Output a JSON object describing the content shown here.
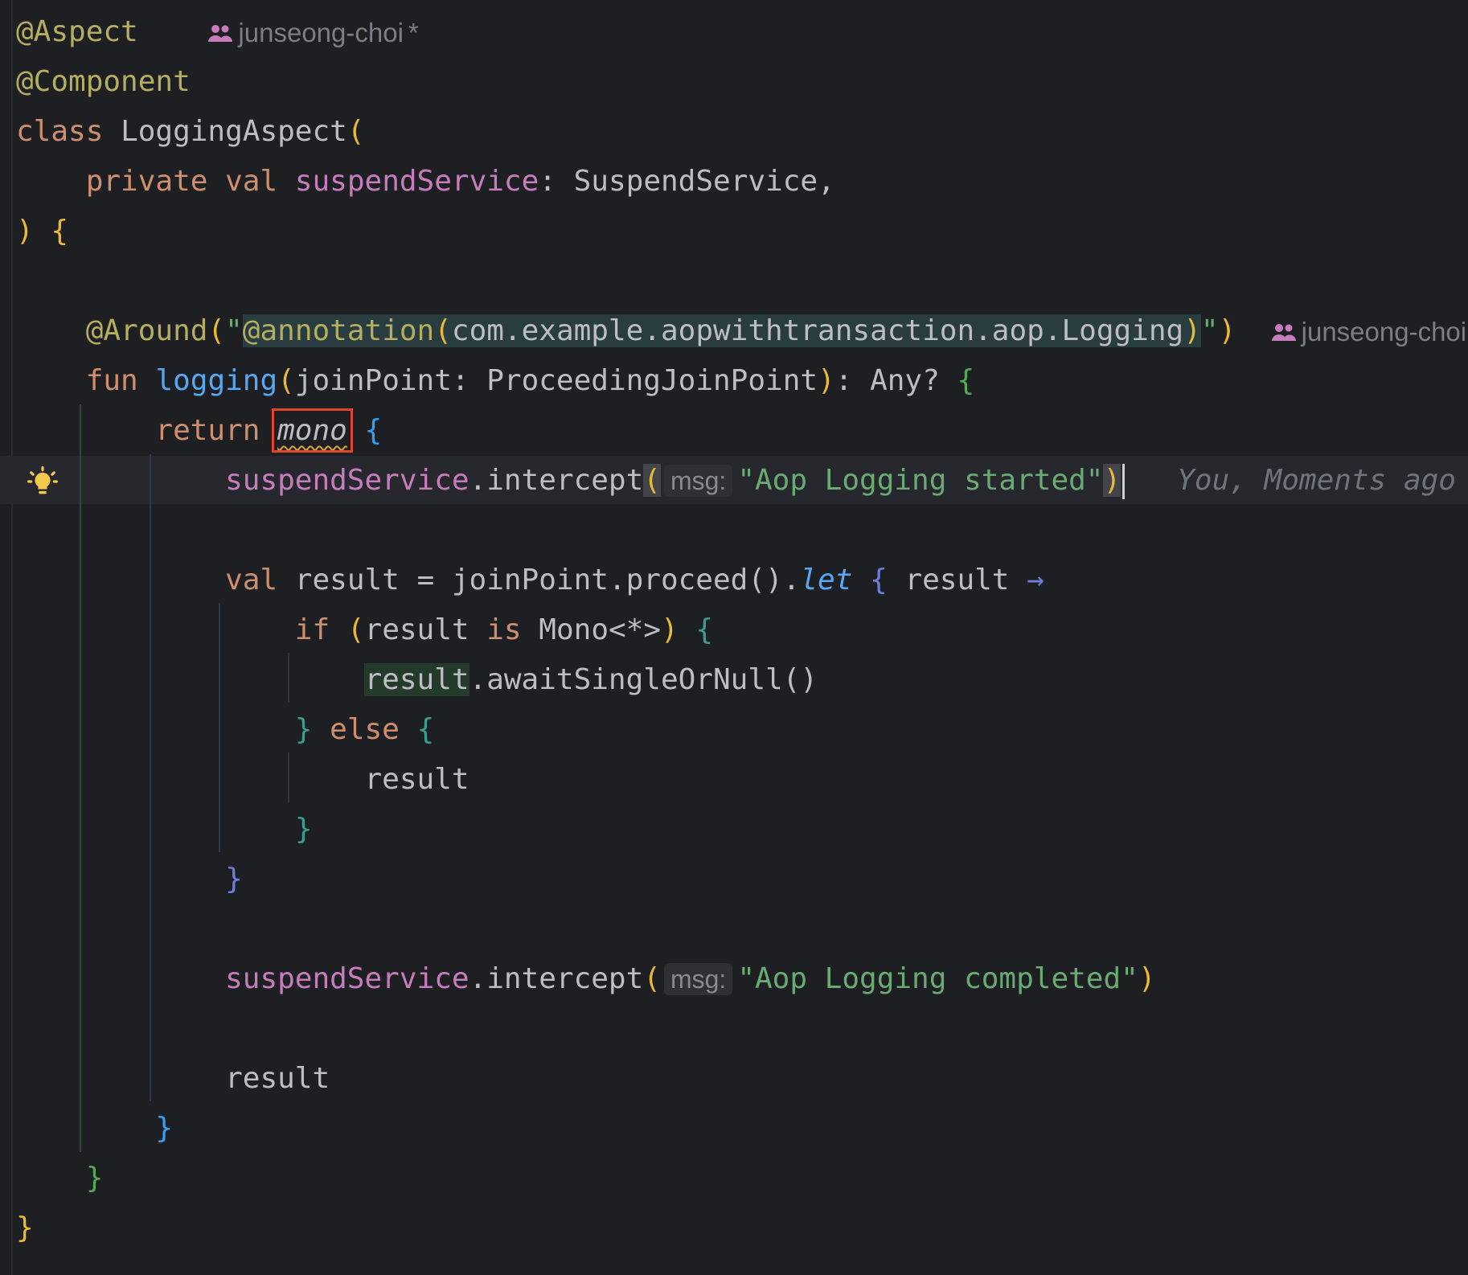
{
  "author": {
    "name": "junseong-choi",
    "modified_marker": "*"
  },
  "lines": {
    "l1": "@Aspect",
    "l2": "@Component",
    "l3_kw": "class",
    "l3_name": "LoggingAspect",
    "l4_kw1": "private",
    "l4_kw2": "val",
    "l4_prop": "suspendService",
    "l4_type": "SuspendService,",
    "l7_ann": "@Around",
    "l7_inner_ann": "@annotation",
    "l7_inner": "com.example.aopwithtransaction.aop.Logging",
    "l8_kw": "fun",
    "l8_fn": "logging",
    "l8_params": "joinPoint: ProceedingJoinPoint",
    "l8_ret": ": Any? ",
    "l9_kw": "return",
    "l9_call": "mono",
    "l10_prop": "suspendService",
    "l10_method": ".intercept",
    "hint_label": "msg:",
    "l10_str": "\"Aop Logging started\"",
    "blame": "You, Moments ago",
    "l12_kw": "val",
    "l12_text": " result = joinPoint.proceed()",
    "l12_let": "let",
    "l12_param": " result ",
    "arrow": "→",
    "l13_if": "if",
    "l13_result": "result",
    "l13_is": "is",
    "l13_type": "Mono<*>",
    "l14_var": "result",
    "l14_method": ".awaitSingleOrNull()",
    "l15_else": "else",
    "l16_var": "result",
    "l20_prop": "suspendService",
    "l20_method": ".intercept",
    "l20_str": "\"Aop Logging completed\"",
    "l22_var": "result"
  },
  "colors": {
    "background": "#1e1f22",
    "keyword": "#cf8e6d",
    "annotation": "#b3ae60",
    "property": "#c77dbb",
    "function": "#56a8f5",
    "string": "#6aab73",
    "warning_box": "#e0452b"
  },
  "icons": {
    "gutter": "lightbulb-icon",
    "author": "people-icon"
  }
}
